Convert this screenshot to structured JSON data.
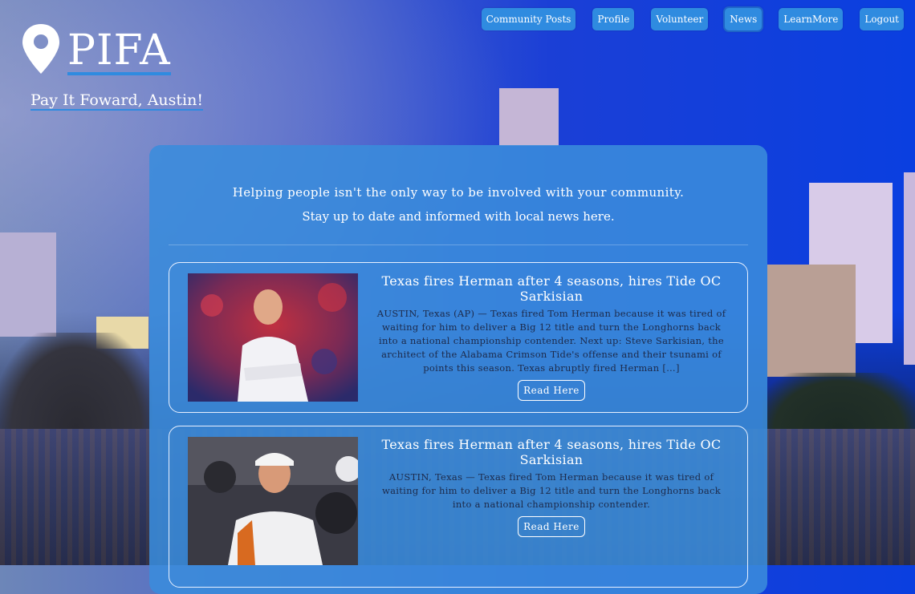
{
  "brand": {
    "name": "PIFA",
    "tagline": "Pay It Foward, Austin!"
  },
  "nav": [
    {
      "label": "Community Posts",
      "active": false
    },
    {
      "label": "Profile",
      "active": false
    },
    {
      "label": "Volunteer",
      "active": false
    },
    {
      "label": "News",
      "active": true
    },
    {
      "label": "LearnMore",
      "active": false
    },
    {
      "label": "Logout",
      "active": false
    }
  ],
  "intro": {
    "line1": "Helping people isn't the only way to be involved with your community.",
    "line2": "Stay up to date and informed with local news here."
  },
  "articles": [
    {
      "headline": "Texas fires Herman after 4 seasons, hires Tide OC Sarkisian",
      "summary": "AUSTIN, Texas (AP) — Texas fired Tom Herman because it was tired of waiting for him to deliver a Big 12 title and turn the Longhorns back into a national championship contender. Next up: Steve Sarkisian, the architect of the Alabama Crimson Tide's offense and their tsunami of points this season. Texas abruptly fired Herman […]",
      "button": "Read Here"
    },
    {
      "headline": "Texas fires Herman after 4 seasons, hires Tide OC Sarkisian",
      "summary": "AUSTIN, Texas — Texas fired Tom Herman because it was tired of waiting for him to deliver a Big 12 title and turn the Longhorns back into a national championship contender.",
      "button": "Read Here"
    }
  ],
  "colors": {
    "accent": "#2f8be0",
    "panel": "#3a8cdc",
    "text_dark": "#1d2a4a"
  }
}
